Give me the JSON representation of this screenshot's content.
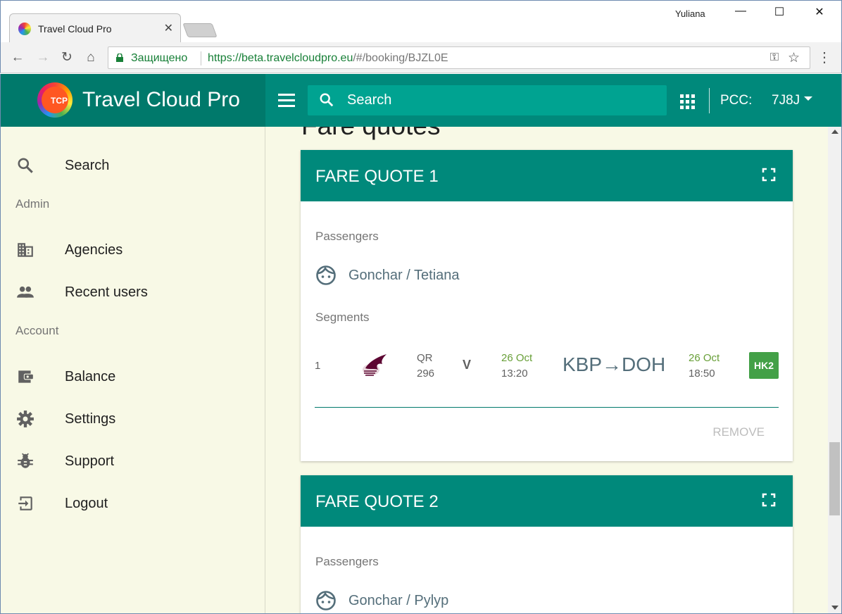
{
  "browser": {
    "tab_title": "Travel Cloud Pro",
    "profile_name": "Yuliana",
    "secure_label": "Защищено",
    "url_host": "https://beta.travelcloudpro.eu",
    "url_path": "/#/booking/BJZL0E"
  },
  "app": {
    "logo_text": "TCP",
    "brand_name": "Travel Cloud Pro",
    "search_placeholder": "Search",
    "pcc_label": "PCC:",
    "pcc_value": "7J8J"
  },
  "sidebar": {
    "search_label": "Search",
    "admin_heading": "Admin",
    "agencies_label": "Agencies",
    "recent_users_label": "Recent users",
    "account_heading": "Account",
    "balance_label": "Balance",
    "settings_label": "Settings",
    "support_label": "Support",
    "logout_label": "Logout"
  },
  "main": {
    "page_title": "Fare quotes",
    "fare_quotes": [
      {
        "title": "FARE QUOTE 1",
        "passengers_label": "Passengers",
        "passenger": "Gonchar / Tetiana",
        "segments_label": "Segments",
        "segment": {
          "num": "1",
          "airline": "QR",
          "flight": "296",
          "class": "V",
          "dep_date": "26 Oct",
          "dep_time": "13:20",
          "route": "KBP→DOH",
          "arr_date": "26 Oct",
          "arr_time": "18:50",
          "status": "HK2"
        },
        "remove_label": "REMOVE"
      },
      {
        "title": "FARE QUOTE 2",
        "passengers_label": "Passengers",
        "passenger": "Gonchar / Pylyp"
      }
    ]
  },
  "colors": {
    "primary": "#00897b",
    "primary_dark": "#00796b",
    "status_green": "#43a047",
    "background": "#f8f9e6"
  }
}
